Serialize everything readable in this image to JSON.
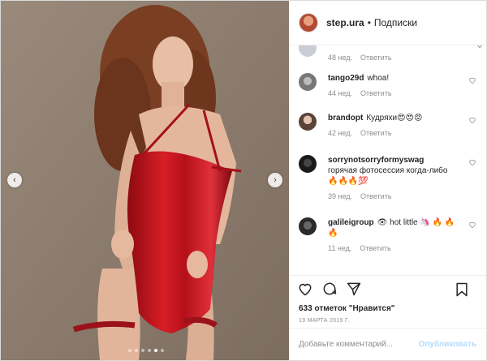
{
  "header": {
    "username": "step.ura",
    "separator": "•",
    "follow_label": "Подписки"
  },
  "top_partial": {
    "time": "48 нед.",
    "reply": "Ответить"
  },
  "comments": [
    {
      "username": "tango29d",
      "text": "whoa!",
      "time": "44 нед.",
      "reply": "Ответить"
    },
    {
      "username": "brandopt",
      "text": "Кудряхи😍😍😡",
      "time": "42 нед.",
      "reply": "Ответить"
    },
    {
      "username": "sorrynotsorryformyswag",
      "text": "горячая фотосессия когда-либо 🔥🔥🔥💯",
      "time": "39 нед.",
      "reply": "Ответить"
    },
    {
      "username": "galileigroup",
      "text": "👁 hot little 🦄 🔥 🔥🔥",
      "time": "11 нед.",
      "reply": "Ответить"
    }
  ],
  "likes": {
    "count": "633",
    "text": "отметок \"Нравится\""
  },
  "date": "19 МАРТА 2019 Г.",
  "add_comment": {
    "placeholder": "Добавьте комментарий...",
    "publish": "Опубликовать"
  },
  "carousel": {
    "prev": "‹",
    "next": "›",
    "dots_total": 6,
    "dot_active": 5
  },
  "colors": {
    "dress": "#c8141c",
    "wall": "#8e7e6f",
    "link_disabled": "#b3dbff"
  },
  "icons": [
    "heart-icon",
    "comment-icon",
    "share-icon",
    "bookmark-icon",
    "chevron-left-icon",
    "chevron-right-icon"
  ]
}
